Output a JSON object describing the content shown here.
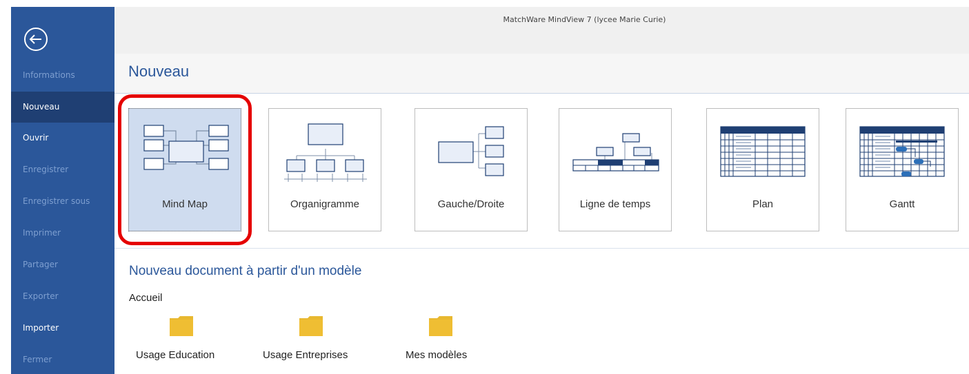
{
  "window": {
    "title": "MatchWare MindView 7 (lycee Marie Curie)"
  },
  "sidebar": {
    "items": [
      {
        "label": "Informations",
        "state": "disabled"
      },
      {
        "label": "Nouveau",
        "state": "selected"
      },
      {
        "label": "Ouvrir",
        "state": "enabled"
      },
      {
        "label": "Enregistrer",
        "state": "disabled"
      },
      {
        "label": "Enregistrer sous",
        "state": "disabled"
      },
      {
        "label": "Imprimer",
        "state": "disabled"
      },
      {
        "label": "Partager",
        "state": "disabled"
      },
      {
        "label": "Exporter",
        "state": "disabled"
      },
      {
        "label": "Importer",
        "state": "enabled"
      },
      {
        "label": "Fermer",
        "state": "disabled"
      }
    ]
  },
  "main": {
    "title": "Nouveau",
    "documents": [
      {
        "label": "Mind Map",
        "icon": "mind-map-icon",
        "selected": true
      },
      {
        "label": "Organigramme",
        "icon": "org-chart-icon",
        "selected": false
      },
      {
        "label": "Gauche/Droite",
        "icon": "left-right-icon",
        "selected": false
      },
      {
        "label": "Ligne de temps",
        "icon": "timeline-icon",
        "selected": false
      },
      {
        "label": "Plan",
        "icon": "outline-icon",
        "selected": false
      },
      {
        "label": "Gantt",
        "icon": "gantt-icon",
        "selected": false
      }
    ],
    "templates": {
      "title": "Nouveau document à partir d'un modèle",
      "breadcrumb": "Accueil",
      "folders": [
        {
          "label": "Usage Education",
          "icon": "folder-icon"
        },
        {
          "label": "Usage Entreprises",
          "icon": "folder-icon"
        },
        {
          "label": "Mes modèles",
          "icon": "folder-icon"
        }
      ]
    }
  },
  "colors": {
    "accent": "#2b579a",
    "sidebar_selected": "#1f3f73",
    "card_selected": "#cfdcef",
    "highlight": "#e50000",
    "folder": "#e8b830",
    "icon_dark": "#1f3f73"
  }
}
